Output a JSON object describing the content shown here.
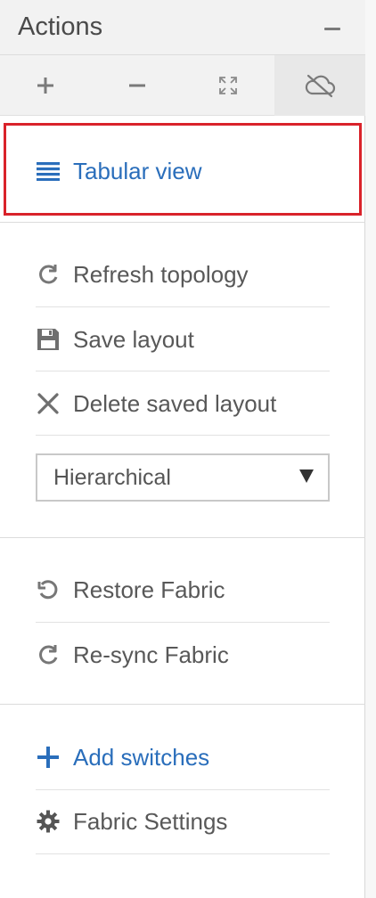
{
  "header": {
    "title": "Actions"
  },
  "toolbar": {
    "tools": [
      "zoom-in-icon",
      "zoom-out-icon",
      "fit-screen-icon",
      "cloud-off-icon"
    ]
  },
  "actions": {
    "tabular_view": "Tabular view",
    "refresh_topology": "Refresh topology",
    "save_layout": "Save layout",
    "delete_saved_layout": "Delete saved layout",
    "layout_select": {
      "selected": "Hierarchical"
    },
    "restore_fabric": "Restore Fabric",
    "resync_fabric": "Re-sync Fabric",
    "add_switches": "Add switches",
    "fabric_settings": "Fabric Settings"
  },
  "colors": {
    "accent_blue": "#2a6ebb",
    "highlight_red": "#d9222a",
    "icon_gray": "#6f6f6f"
  }
}
